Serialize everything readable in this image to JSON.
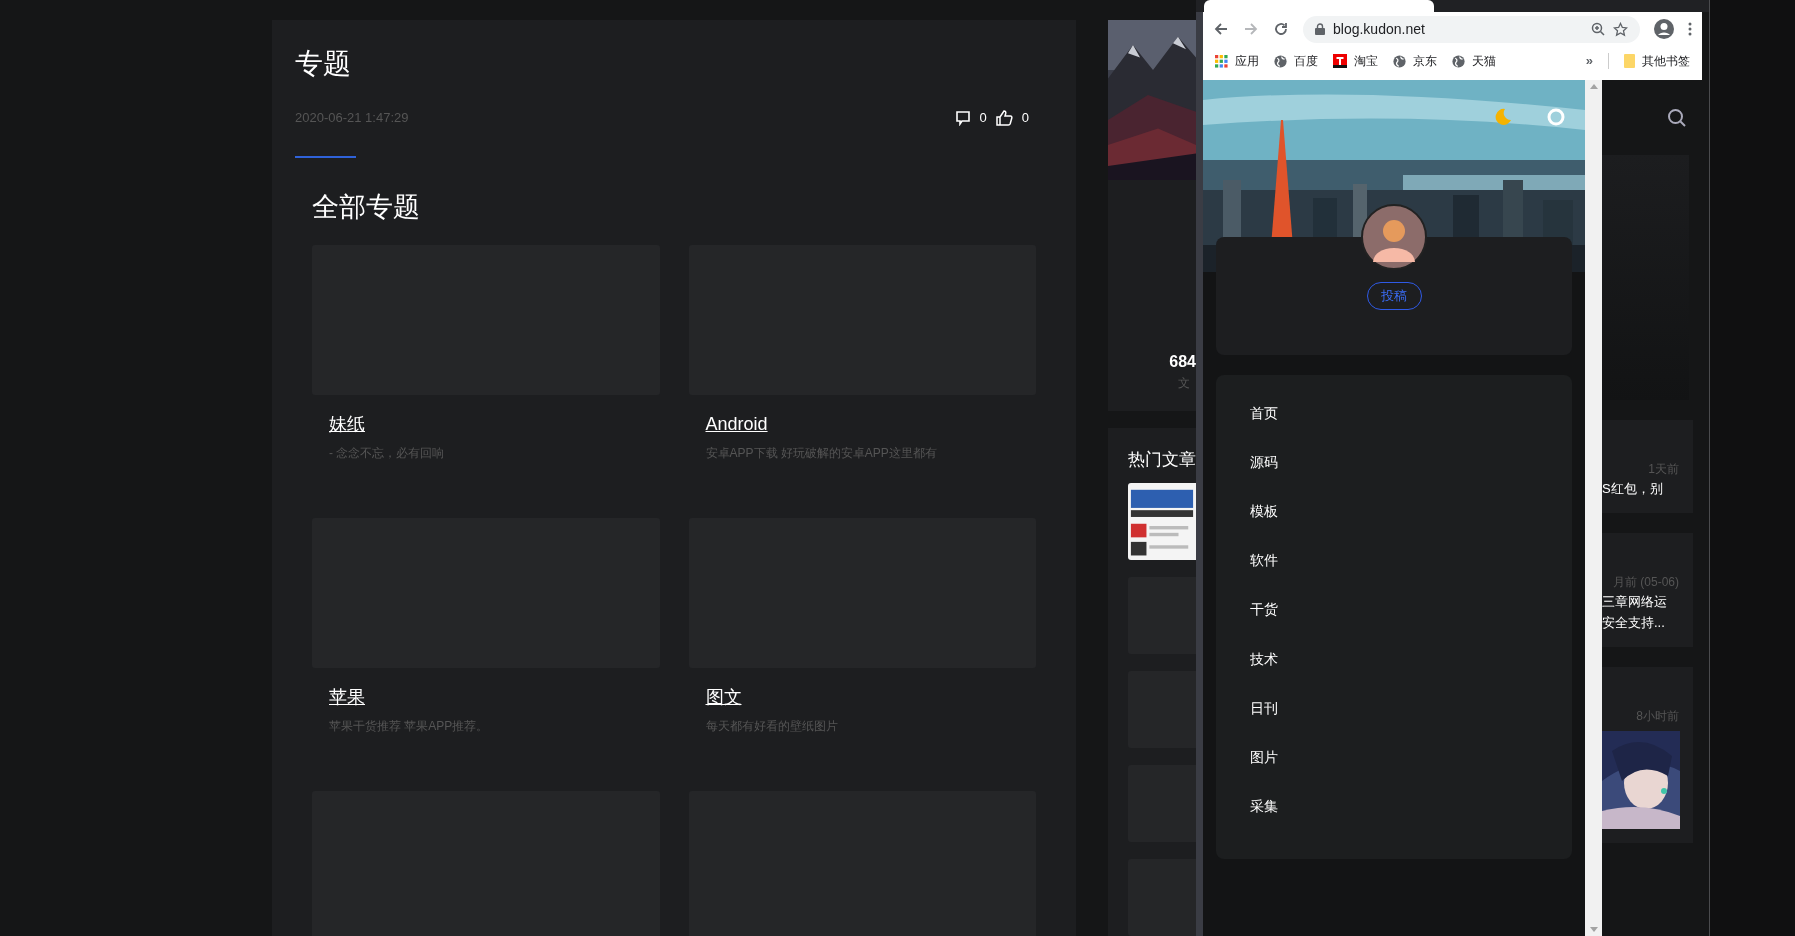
{
  "article": {
    "title": "专题",
    "date": "2020-06-21 1:47:29",
    "comments": "0",
    "likes": "0"
  },
  "section_title": "全部专题",
  "topics": [
    {
      "kind": "topic",
      "title": "妹纸",
      "description": "- 念念不忘，必有回响"
    },
    {
      "kind": "topic",
      "title": "Android",
      "description": "安卓APP下载 好玩破解的安卓APP这里都有"
    },
    {
      "kind": "topic",
      "title": "苹果",
      "description": "苹果干货推荐 苹果APP推荐。"
    },
    {
      "kind": "topic",
      "title": "图文",
      "description": "每天都有好看的壁纸图片"
    },
    {
      "kind": "image_only"
    },
    {
      "kind": "image_only"
    }
  ],
  "side_column": {
    "stat_value": "684",
    "stat_label": "文",
    "hot_title": "热门文章"
  },
  "browser": {
    "url": "blog.kudon.net",
    "bookmarks": [
      {
        "label": "应用",
        "kind": "apps"
      },
      {
        "label": "百度",
        "kind": "globe"
      },
      {
        "label": "淘宝",
        "kind": "taobao"
      },
      {
        "label": "京东",
        "kind": "globe"
      },
      {
        "label": "天猫",
        "kind": "globe"
      }
    ],
    "overflow": "»",
    "other_bookmarks": "其他书签"
  },
  "site": {
    "submit_button": "投稿",
    "menu": [
      "首页",
      "源码",
      "模板",
      "软件",
      "干货",
      "技术",
      "日刊",
      "图片",
      "采集"
    ]
  },
  "behind_column": {
    "posts": [
      {
        "kind": "text",
        "time": "1天前",
        "lines": [
          "S红包，别"
        ]
      },
      {
        "kind": "text",
        "time": "月前 (05-06)",
        "lines": [
          "三章网络运",
          "安全支持..."
        ]
      },
      {
        "kind": "picture",
        "time": "8小时前"
      }
    ]
  }
}
